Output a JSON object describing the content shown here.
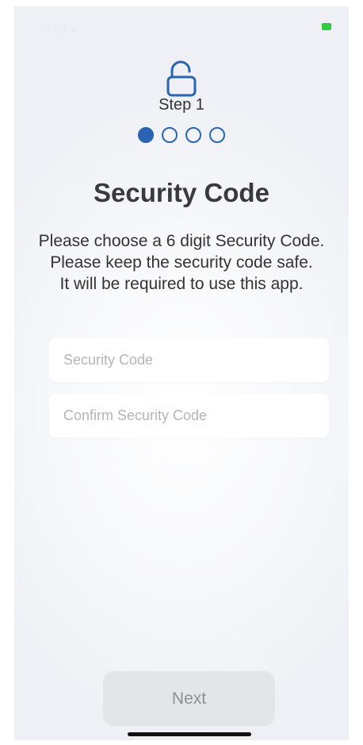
{
  "status_bar": {
    "time": "19:32 ◂",
    "icons": [
      "wifi-icon",
      "battery-icon"
    ]
  },
  "header": {
    "icon": "lock-open-icon",
    "step_label": "Step 1",
    "steps_total": 4,
    "steps_active": 1
  },
  "main": {
    "title": "Security Code",
    "description_line1": "Please choose a 6 digit Security Code.",
    "description_line2": "Please keep the security code safe.",
    "description_line3": "It will be required to use this app."
  },
  "form": {
    "security_code": {
      "placeholder": "Security Code",
      "value": ""
    },
    "confirm_code": {
      "placeholder": "Confirm Security Code",
      "value": ""
    }
  },
  "footer": {
    "next_label": "Next"
  },
  "colors": {
    "accent": "#2a64b3",
    "title": "#3a3a3c",
    "button_bg": "#e3e5e9",
    "button_text": "#8c8f96",
    "battery": "#2ecc40"
  }
}
